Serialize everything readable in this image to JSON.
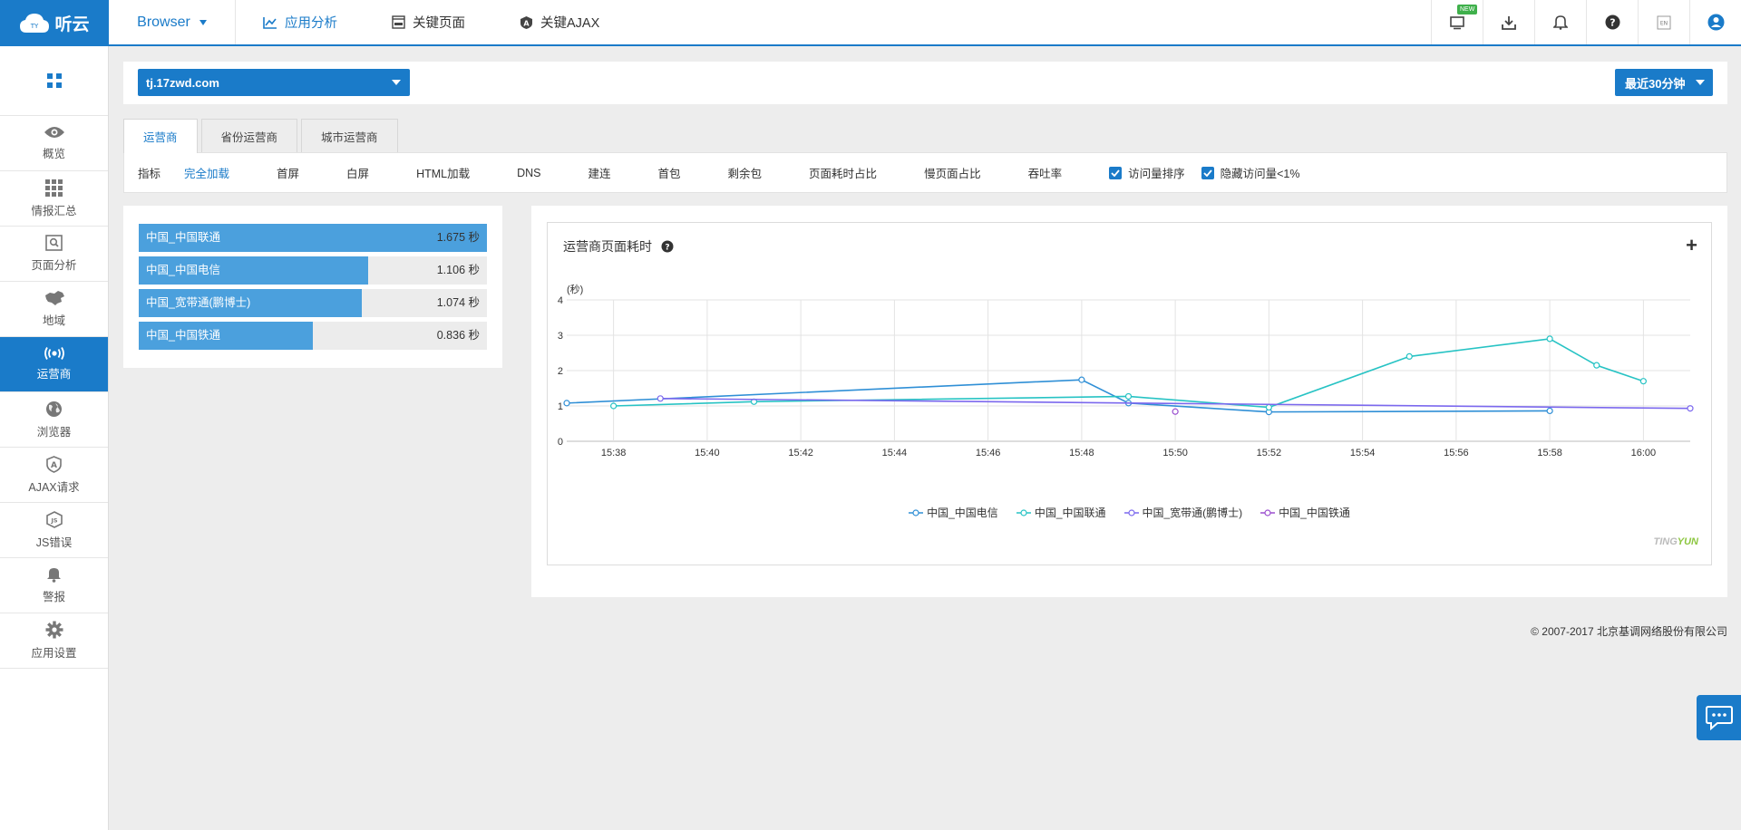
{
  "app": {
    "logo_text": "听云",
    "logo_sub": "TINGYUN",
    "product": "Browser"
  },
  "topnav": [
    {
      "label": "应用分析",
      "icon": "line-chart-icon",
      "active": true
    },
    {
      "label": "关键页面",
      "icon": "url-page-icon",
      "active": false
    },
    {
      "label": "关键AJAX",
      "icon": "ajax-shield-icon",
      "active": false
    }
  ],
  "topicons": {
    "new_badge": "NEW",
    "lang": "EN"
  },
  "sidebar": {
    "items": [
      {
        "label": "概览",
        "icon": "eye-icon"
      },
      {
        "label": "情报汇总",
        "icon": "grid-icon"
      },
      {
        "label": "页面分析",
        "icon": "page-search-icon"
      },
      {
        "label": "地域",
        "icon": "map-icon"
      },
      {
        "label": "运营商",
        "icon": "signal-icon",
        "active": true
      },
      {
        "label": "浏览器",
        "icon": "globe-icon"
      },
      {
        "label": "AJAX请求",
        "icon": "ajax-icon"
      },
      {
        "label": "JS错误",
        "icon": "js-error-icon"
      },
      {
        "label": "警报",
        "icon": "bell-icon"
      },
      {
        "label": "应用设置",
        "icon": "gear-icon"
      }
    ]
  },
  "filter": {
    "site": "tj.17zwd.com",
    "time_range": "最近30分钟"
  },
  "tabs": [
    {
      "label": "运营商",
      "active": true
    },
    {
      "label": "省份运营商",
      "active": false
    },
    {
      "label": "城市运营商",
      "active": false
    }
  ],
  "metrics": {
    "label": "指标",
    "items": [
      "完全加载",
      "首屏",
      "白屏",
      "HTML加载",
      "DNS",
      "建连",
      "首包",
      "剩余包",
      "页面耗时占比",
      "慢页面占比",
      "吞吐率"
    ],
    "active_index": 0,
    "checkboxes": [
      {
        "label": "访问量排序",
        "checked": true
      },
      {
        "label": "隐藏访问量<1%",
        "checked": true
      }
    ]
  },
  "ranking": [
    {
      "name": "中国_中国联通",
      "value": "1.675 秒",
      "ratio": 1.0
    },
    {
      "name": "中国_中国电信",
      "value": "1.106 秒",
      "ratio": 0.66
    },
    {
      "name": "中国_宽带通(鹏博士)",
      "value": "1.074 秒",
      "ratio": 0.641
    },
    {
      "name": "中国_中国铁通",
      "value": "0.836 秒",
      "ratio": 0.499
    }
  ],
  "chart_panel": {
    "title": "运营商页面耗时",
    "help_icon": "question-circle-icon",
    "add_icon": "plus-icon",
    "watermark_a": "TING",
    "watermark_b": "YUN"
  },
  "chart_data": {
    "type": "line",
    "title": "运营商页面耗时",
    "ylabel": "(秒)",
    "ylim": [
      0,
      4
    ],
    "yticks": [
      0,
      1,
      2,
      3,
      4
    ],
    "xlim": [
      "15:37",
      "16:01"
    ],
    "xticks": [
      "15:38",
      "15:40",
      "15:42",
      "15:44",
      "15:46",
      "15:48",
      "15:50",
      "15:52",
      "15:54",
      "15:56",
      "15:58",
      "16:00"
    ],
    "grid": true,
    "legend_position": "bottom",
    "series": [
      {
        "name": "中国_中国电信",
        "color": "#2f8fd6",
        "x": [
          "15:37",
          "15:48",
          "15:49",
          "15:52",
          "15:58"
        ],
        "y": [
          1.08,
          1.74,
          1.08,
          0.83,
          0.86
        ]
      },
      {
        "name": "中国_中国联通",
        "color": "#27c3c4",
        "x": [
          "15:38",
          "15:41",
          "15:49",
          "15:52",
          "15:55",
          "15:58",
          "15:59",
          "16:00"
        ],
        "y": [
          1.0,
          1.12,
          1.27,
          0.96,
          2.4,
          2.9,
          2.15,
          1.7
        ]
      },
      {
        "name": "中国_宽带通(鹏博士)",
        "color": "#7b68ee",
        "x": [
          "15:39",
          "16:01"
        ],
        "y": [
          1.21,
          0.93
        ]
      },
      {
        "name": "中国_中国铁通",
        "color": "#9b4fcf",
        "x": [
          "15:50"
        ],
        "y": [
          0.84
        ]
      }
    ]
  },
  "footer": {
    "copyright": "© 2007-2017  北京基调网络股份有限公司"
  }
}
